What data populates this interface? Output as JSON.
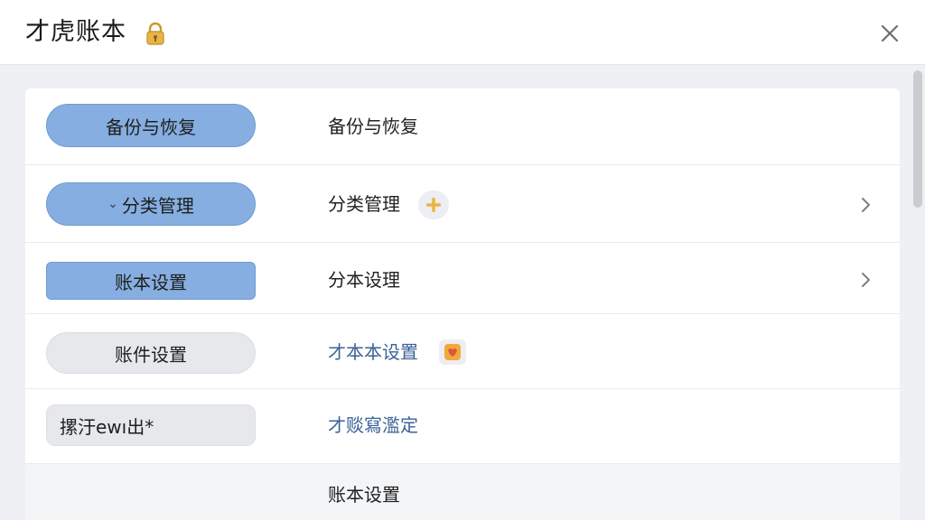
{
  "app": {
    "title": "才虎账本",
    "icons": {
      "lock": "lock-icon",
      "close": "close-icon"
    }
  },
  "rows": [
    {
      "button_label": "备份与恢复",
      "label": "备份与恢复",
      "button_style": "blue"
    },
    {
      "button_chevron": "⌄",
      "button_label": "分类管理",
      "label": "分类管理",
      "button_style": "blue",
      "trailing_icon": "plus-icon",
      "has_chevron": true
    },
    {
      "button_label": "账本设置",
      "label": "分本设理",
      "button_style": "blue",
      "has_chevron": true
    },
    {
      "button_label": "账件设置",
      "label": "才本本设置",
      "button_style": "gray",
      "trailing_icon": "heart-badge-icon"
    },
    {
      "button_label": "摞汙ewı出*",
      "label": "才赕寫濫定",
      "button_style": "gray"
    },
    {
      "label": "账本设置"
    }
  ],
  "colors": {
    "accent_blue": "#86aee0",
    "pill_gray": "#e6e8eb",
    "link_blue": "#3b6296",
    "plus_yellow": "#e8b640",
    "badge_orange": "#f2a93b"
  }
}
